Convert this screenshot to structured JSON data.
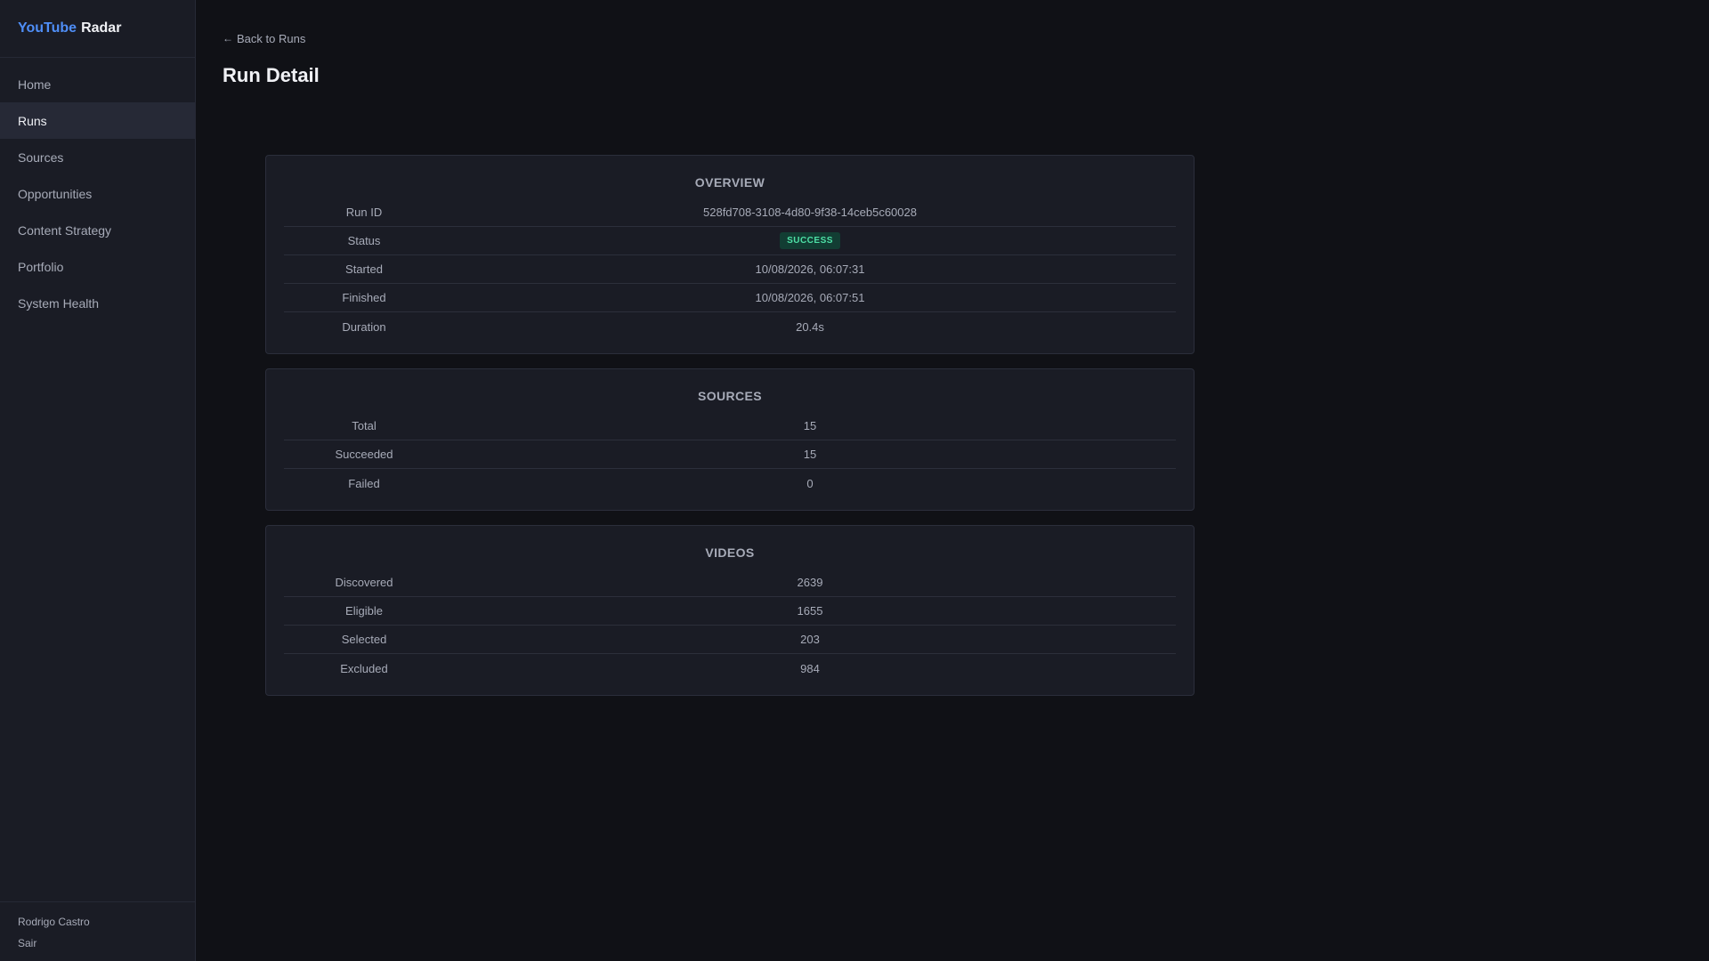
{
  "brand": {
    "accent": "YouTube",
    "rest": "Radar"
  },
  "nav": [
    {
      "label": "Home",
      "active": false
    },
    {
      "label": "Runs",
      "active": true
    },
    {
      "label": "Sources",
      "active": false
    },
    {
      "label": "Opportunities",
      "active": false
    },
    {
      "label": "Content Strategy",
      "active": false
    },
    {
      "label": "Portfolio",
      "active": false
    },
    {
      "label": "System Health",
      "active": false
    }
  ],
  "user": {
    "name": "Rodrigo Castro",
    "logout": "Sair"
  },
  "header": {
    "back_arrow": "←",
    "back_label": "Back to Runs",
    "title": "Run Detail"
  },
  "overview": {
    "title": "OVERVIEW",
    "rows": [
      {
        "label": "Run ID",
        "value": "528fd708-3108-4d80-9f38-14ceb5c60028"
      },
      {
        "label": "Status",
        "value": "SUCCESS"
      },
      {
        "label": "Started",
        "value": "10/08/2026, 06:07:31"
      },
      {
        "label": "Finished",
        "value": "10/08/2026, 06:07:51"
      },
      {
        "label": "Duration",
        "value": "20.4s"
      }
    ]
  },
  "sources": {
    "title": "SOURCES",
    "rows": [
      {
        "label": "Total",
        "value": "15"
      },
      {
        "label": "Succeeded",
        "value": "15"
      },
      {
        "label": "Failed",
        "value": "0"
      }
    ]
  },
  "videos": {
    "title": "VIDEOS",
    "rows": [
      {
        "label": "Discovered",
        "value": "2639"
      },
      {
        "label": "Eligible",
        "value": "1655"
      },
      {
        "label": "Selected",
        "value": "203"
      },
      {
        "label": "Excluded",
        "value": "984"
      }
    ]
  },
  "colors": {
    "accent": "#4f8ef7",
    "success_bg": "#123d33",
    "success_text": "#4ee0a6",
    "background": "#101116",
    "panel": "#1a1c25"
  }
}
